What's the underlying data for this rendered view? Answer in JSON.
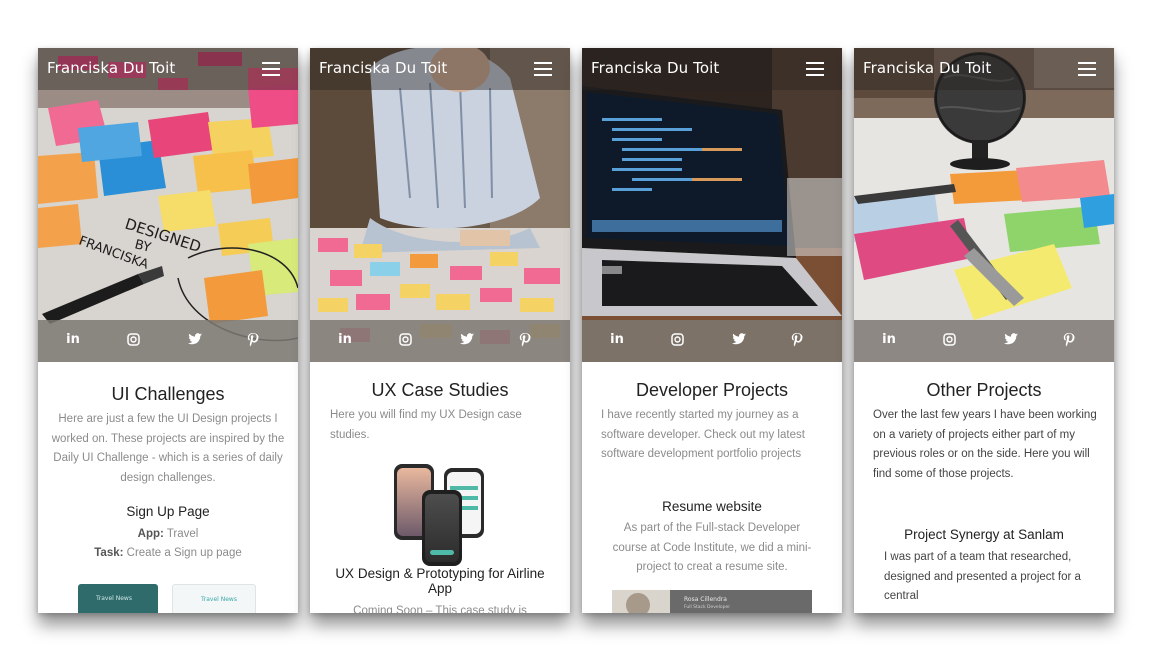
{
  "brand": "Franciska Du Toit",
  "social_icons": [
    "linkedin-icon",
    "instagram-icon",
    "twitter-icon",
    "pinterest-icon"
  ],
  "social_text": {
    "linkedin": "in"
  },
  "cards": [
    {
      "title": "UI Challenges",
      "description": "Here are just a few the UI Design projects I worked on. These projects are inspired by the Daily UI Challenge - which is a series of daily design challenges.",
      "project_title": "Sign Up Page",
      "app_label": "App:",
      "app_value": "Travel",
      "task_label": "Task:",
      "task_value": "Create a Sign up page",
      "preview_left": "Travel News",
      "preview_right": "Travel News",
      "image_note_1": "DESIGNED",
      "image_note_2": "BY",
      "image_note_3": "FRANCISKA"
    },
    {
      "title": "UX Case Studies",
      "description": "Here you will find my UX Design case studies.",
      "project_title": "UX Design & Prototyping for Airline App",
      "teaser": "Coming Soon – This case study is"
    },
    {
      "title": "Developer Projects",
      "description": "I have recently started my journey as a software developer. Check out my latest software development portfolio projects",
      "project_title": "Resume website",
      "project_text": "As part of the Full-stack Developer course at Code Institute, we did a mini-project to creat a resume site.",
      "preview_name": "Rosa Cillendra",
      "preview_role": "Full Stack Developer"
    },
    {
      "title": "Other Projects",
      "description": "Over the last few years I have been working on a variety of projects either part of my previous roles or on the side. Here you will find some of those projects.",
      "project_title": "Project Synergy at Sanlam",
      "project_text": "I was part of a team that researched, designed and presented a project for a central"
    }
  ],
  "colors": {
    "topbar_overlay": "#282422",
    "social_bar": "#7d7872",
    "title_text": "#222222",
    "body_text": "#8b8b8b",
    "page_bg": "#ffffff"
  }
}
